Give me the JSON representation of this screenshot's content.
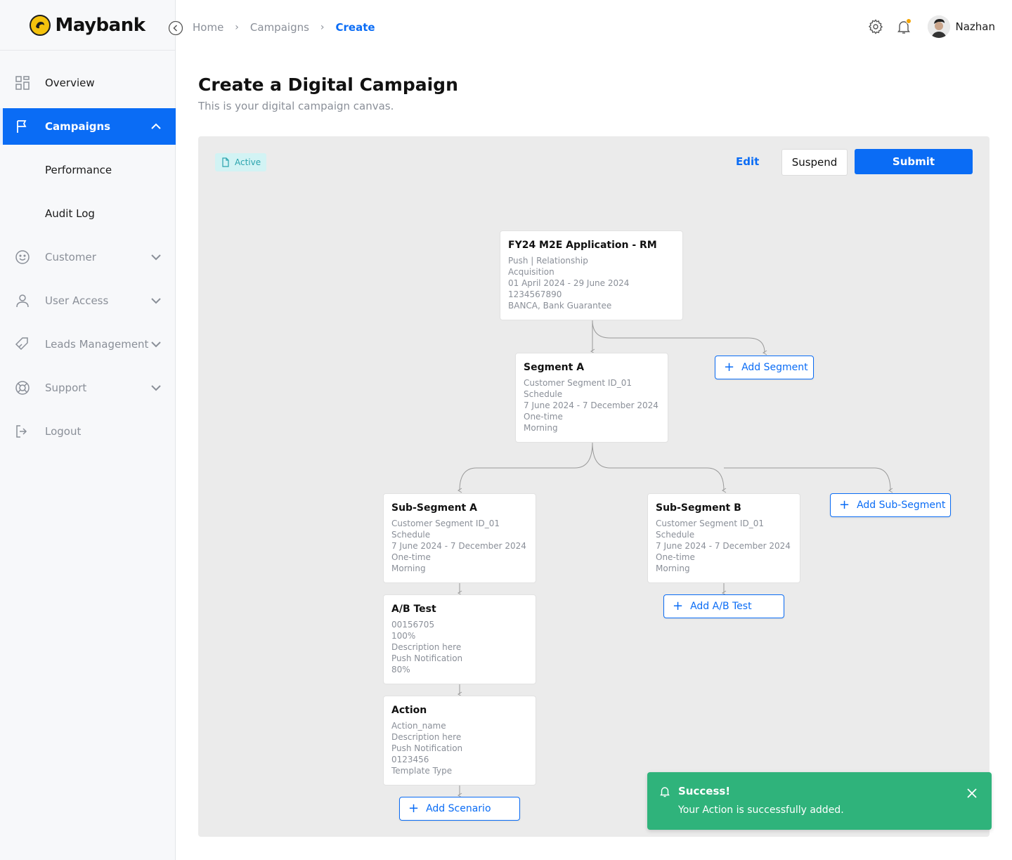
{
  "brand": {
    "name": "Maybank"
  },
  "sidebar": {
    "overview": "Overview",
    "campaigns": "Campaigns",
    "performance": "Performance",
    "audit_log": "Audit Log",
    "customer": "Customer",
    "user_access": "User Access",
    "leads_management": "Leads Management",
    "support": "Support",
    "logout": "Logout"
  },
  "breadcrumb": {
    "home": "Home",
    "campaigns": "Campaigns",
    "current": "Create"
  },
  "user": {
    "name": "Nazhan"
  },
  "page": {
    "title": "Create a Digital Campaign",
    "subtitle": "This is your digital campaign canvas."
  },
  "canvas": {
    "status": "Active",
    "edit": "Edit",
    "suspend": "Suspend",
    "submit": "Submit",
    "campaign": {
      "title": "FY24 M2E Application - RM",
      "line1": "Push  |  Relationship",
      "line2": "Acquisition",
      "line3": "01 April 2024 - 29 June 2024",
      "line4": "1234567890",
      "line5": "BANCA, Bank Guarantee"
    },
    "segment_a": {
      "title": "Segment A",
      "line1": "Customer Segment ID_01",
      "line2": "Schedule",
      "line3": "7 June 2024 - 7 December 2024",
      "line4": "One-time",
      "line5": "Morning"
    },
    "add_segment": "Add Segment",
    "sub_segment_a": {
      "title": "Sub-Segment A",
      "line1": "Customer Segment ID_01",
      "line2": "Schedule",
      "line3": "7 June 2024 - 7 December 2024",
      "line4": "One-time",
      "line5": "Morning"
    },
    "sub_segment_b": {
      "title": "Sub-Segment B",
      "line1": "Customer Segment ID_01",
      "line2": "Schedule",
      "line3": "7 June 2024 - 7 December 2024",
      "line4": "One-time",
      "line5": "Morning"
    },
    "add_sub_segment": "Add Sub-Segment",
    "ab_test": {
      "title": "A/B Test",
      "line1": "00156705",
      "line2": "100%",
      "line3": "Description here",
      "line4": "Push Notification",
      "line5": "80%"
    },
    "add_ab_test": "Add A/B Test",
    "action": {
      "title": "Action",
      "line1": "Action_name",
      "line2": "Description here",
      "line3": "Push Notification",
      "line4": "0123456",
      "line5": "Template Type"
    },
    "add_scenario": "Add Scenario"
  },
  "toast": {
    "title": "Success!",
    "message": "Your Action is successfully added."
  },
  "colors": {
    "primary": "#0a6cf5",
    "success": "#2fb37b",
    "badge_bg": "#d2f3f4",
    "badge_text": "#2aa3ad"
  },
  "icons": [
    "grid-icon",
    "flag-icon",
    "smiley-icon",
    "user-icon",
    "tag-icon",
    "lifebuoy-icon",
    "logout-icon",
    "gear-icon",
    "bell-icon",
    "document-icon",
    "plus-icon",
    "close-icon"
  ]
}
